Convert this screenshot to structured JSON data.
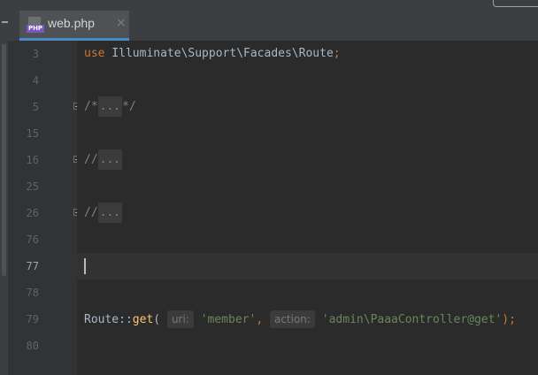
{
  "tab": {
    "title": "web.php",
    "close": "×",
    "icon_label": "PHP"
  },
  "lines": [
    {
      "num": "3"
    },
    {
      "num": "4"
    },
    {
      "num": "5"
    },
    {
      "num": "15"
    },
    {
      "num": "16"
    },
    {
      "num": "25"
    },
    {
      "num": "26"
    },
    {
      "num": "76"
    },
    {
      "num": "77"
    },
    {
      "num": "78"
    },
    {
      "num": "79"
    },
    {
      "num": "80"
    }
  ],
  "code": {
    "l3_kw": "use",
    "l3_rest": " Illuminate\\Support\\Facades\\Route",
    "l3_semi": ";",
    "l5_open": "/*",
    "l5_fold": "...",
    "l5_close": "*/",
    "l16_slash": "//",
    "l16_fold": "...",
    "l26_slash": "//",
    "l26_fold": "...",
    "l79_class": "Route",
    "l79_sep": "::",
    "l79_fn": "get",
    "l79_paren": "( ",
    "l79_hint1": "uri:",
    "l79_str1": "'member'",
    "l79_comma": ", ",
    "l79_hint2": "action:",
    "l79_str2": "'admin\\PaaaController@get'",
    "l79_end": ");"
  },
  "colors": {
    "keyword": "#cc7832",
    "string": "#6a8759",
    "function": "#ffc66d",
    "comment": "#808080",
    "accent": "#4a88c7"
  }
}
